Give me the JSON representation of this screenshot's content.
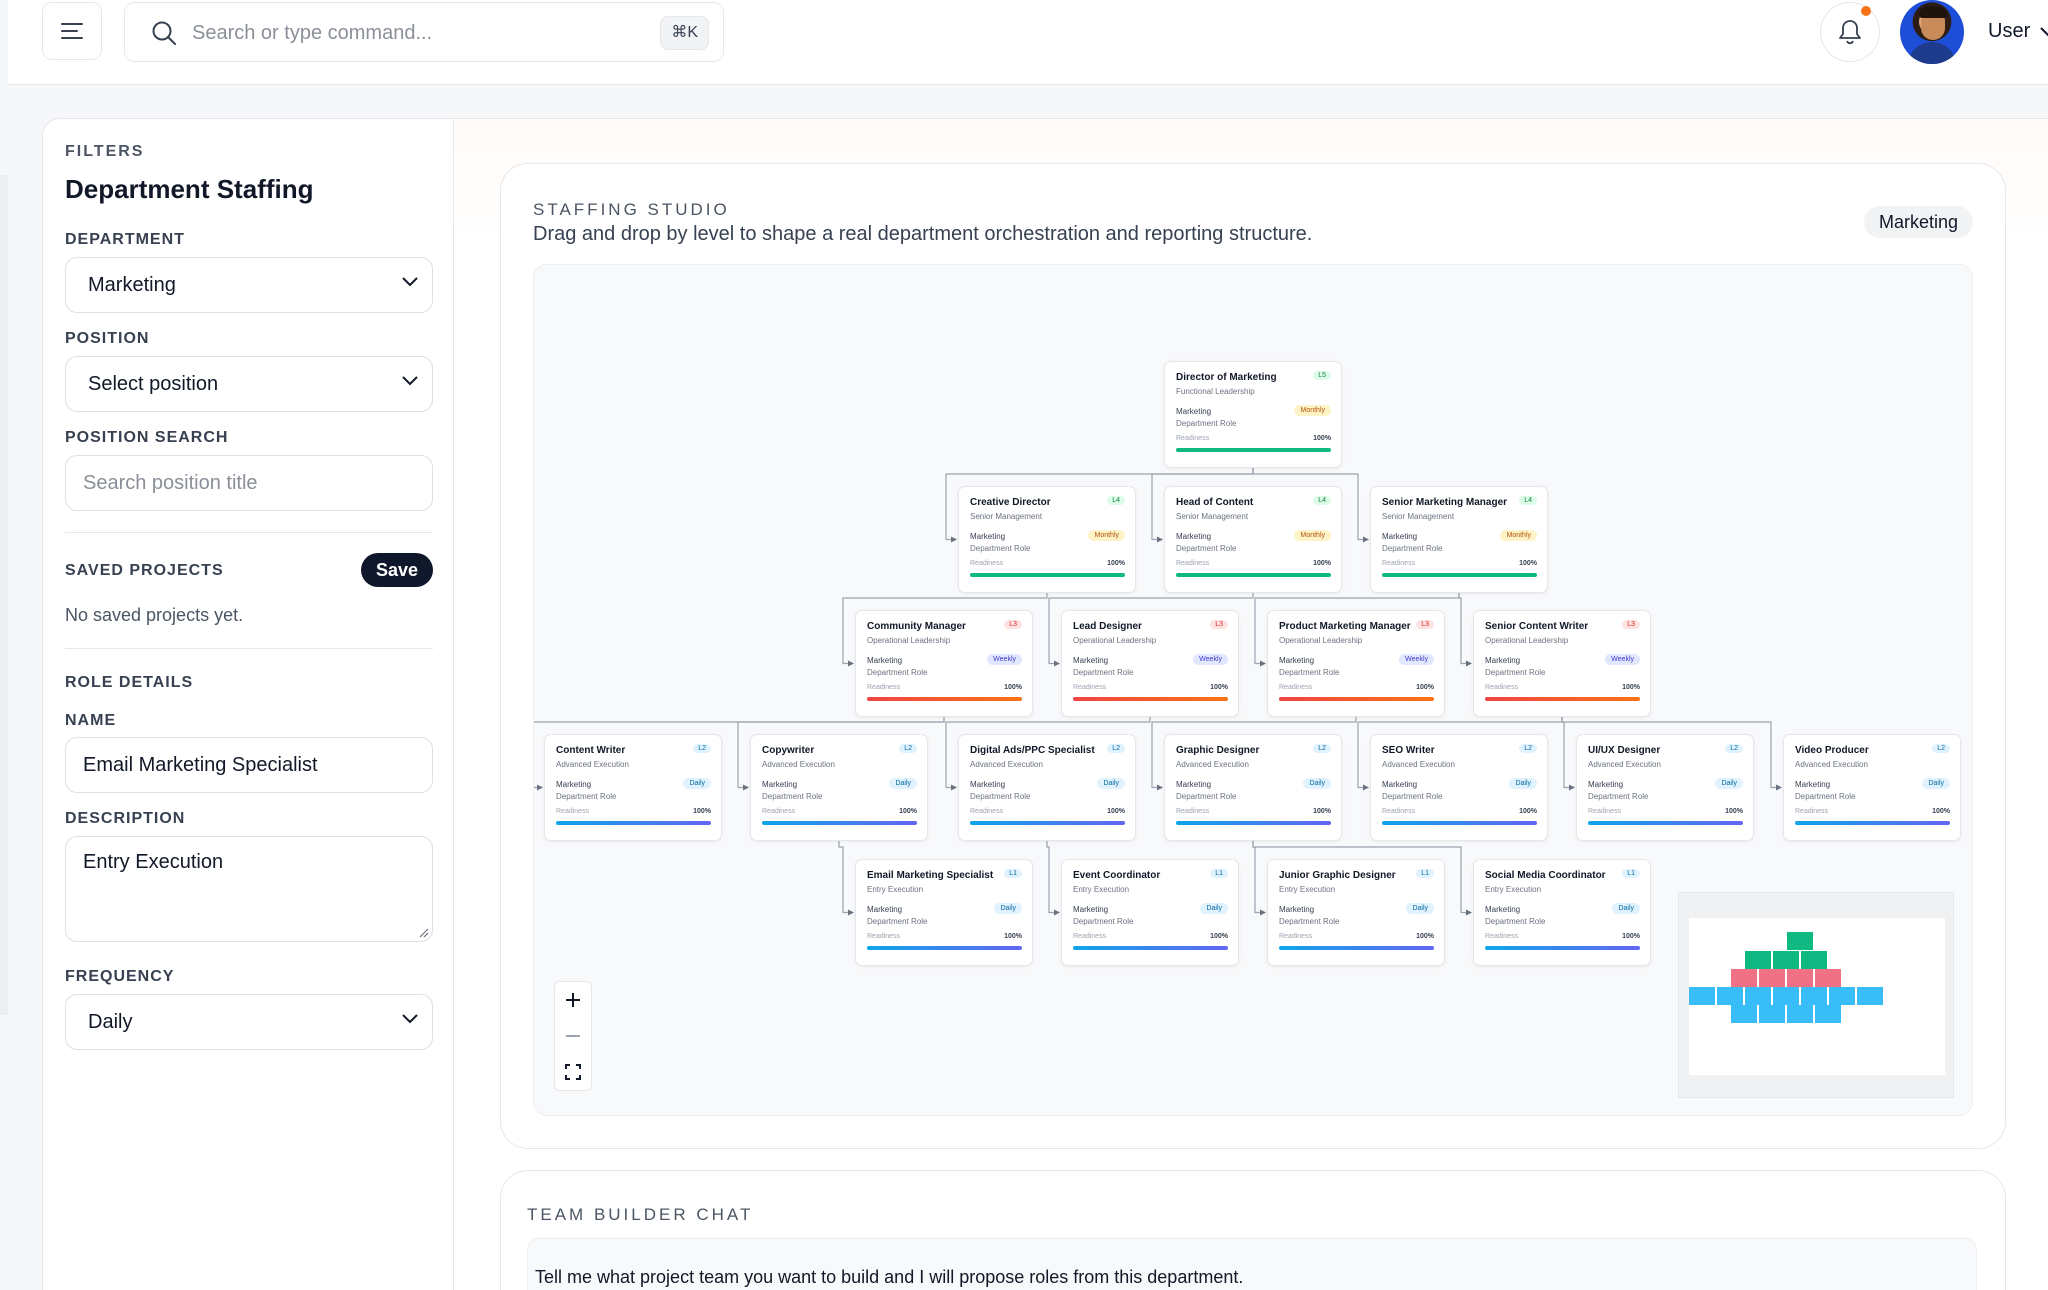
{
  "topbar": {
    "search_placeholder": "Search or type command...",
    "search_shortcut": "⌘K",
    "user_label": "User"
  },
  "sidebar": {
    "filters_label": "FILTERS",
    "title": "Department Staffing",
    "department_label": "DEPARTMENT",
    "department_value": "Marketing",
    "position_label": "POSITION",
    "position_value": "Select position",
    "position_search_label": "POSITION SEARCH",
    "position_search_placeholder": "Search position title",
    "saved_projects_label": "SAVED PROJECTS",
    "save_button": "Save",
    "saved_projects_empty": "No saved projects yet.",
    "role_details_label": "ROLE DETAILS",
    "name_label": "NAME",
    "name_value": "Email Marketing Specialist",
    "description_label": "DESCRIPTION",
    "description_value": "Entry Execution",
    "frequency_label": "FREQUENCY",
    "frequency_value": "Daily"
  },
  "studio": {
    "label": "STAFFING STUDIO",
    "description": "Drag and drop by level to shape a real department orchestration and reporting structure.",
    "department_pill": "Marketing",
    "card_common": {
      "department": "Marketing",
      "department_role": "Department Role",
      "readiness_label": "Readiness",
      "readiness_value": "100%"
    },
    "rows": [
      [
        {
          "title": "Director of Marketing",
          "level": "L5",
          "tier": "Functional Leadership",
          "frequency": "Monthly"
        }
      ],
      [
        {
          "title": "Creative Director",
          "level": "L4",
          "tier": "Senior Management",
          "frequency": "Monthly"
        },
        {
          "title": "Head of Content",
          "level": "L4",
          "tier": "Senior Management",
          "frequency": "Monthly"
        },
        {
          "title": "Senior Marketing Manager",
          "level": "L4",
          "tier": "Senior Management",
          "frequency": "Monthly"
        }
      ],
      [
        {
          "title": "Community Manager",
          "level": "L3",
          "tier": "Operational Leadership",
          "frequency": "Weekly"
        },
        {
          "title": "Lead Designer",
          "level": "L3",
          "tier": "Operational Leadership",
          "frequency": "Weekly"
        },
        {
          "title": "Product Marketing Manager",
          "level": "L3",
          "tier": "Operational Leadership",
          "frequency": "Weekly"
        },
        {
          "title": "Senior Content Writer",
          "level": "L3",
          "tier": "Operational Leadership",
          "frequency": "Weekly"
        }
      ],
      [
        {
          "title": "Content Writer",
          "level": "L2",
          "tier": "Advanced Execution",
          "frequency": "Daily"
        },
        {
          "title": "Copywriter",
          "level": "L2",
          "tier": "Advanced Execution",
          "frequency": "Daily"
        },
        {
          "title": "Digital Ads/PPC Specialist",
          "level": "L2",
          "tier": "Advanced Execution",
          "frequency": "Daily"
        },
        {
          "title": "Graphic Designer",
          "level": "L2",
          "tier": "Advanced Execution",
          "frequency": "Daily"
        },
        {
          "title": "SEO Writer",
          "level": "L2",
          "tier": "Advanced Execution",
          "frequency": "Daily"
        },
        {
          "title": "UI/UX Designer",
          "level": "L2",
          "tier": "Advanced Execution",
          "frequency": "Daily"
        },
        {
          "title": "Video Producer",
          "level": "L2",
          "tier": "Advanced Execution",
          "frequency": "Daily"
        }
      ],
      [
        {
          "title": "Email Marketing Specialist",
          "level": "L1",
          "tier": "Entry Execution",
          "frequency": "Daily"
        },
        {
          "title": "Event Coordinator",
          "level": "L1",
          "tier": "Entry Execution",
          "frequency": "Daily"
        },
        {
          "title": "Junior Graphic Designer",
          "level": "L1",
          "tier": "Entry Execution",
          "frequency": "Daily"
        },
        {
          "title": "Social Media Coordinator",
          "level": "L1",
          "tier": "Entry Execution",
          "frequency": "Daily"
        }
      ]
    ],
    "zoom_controls": {
      "zoom_in": "+",
      "zoom_out": "–",
      "fit": "fit-view-icon"
    },
    "level_colors": {
      "L5": "#10b981",
      "L4": "#10b981",
      "L3": "#f07185",
      "L2": "#38bdf8",
      "L1": "#38bdf8"
    }
  },
  "chat": {
    "label": "TEAM BUILDER CHAT",
    "message": "Tell me what project team you want to build and I will propose roles from this department."
  }
}
